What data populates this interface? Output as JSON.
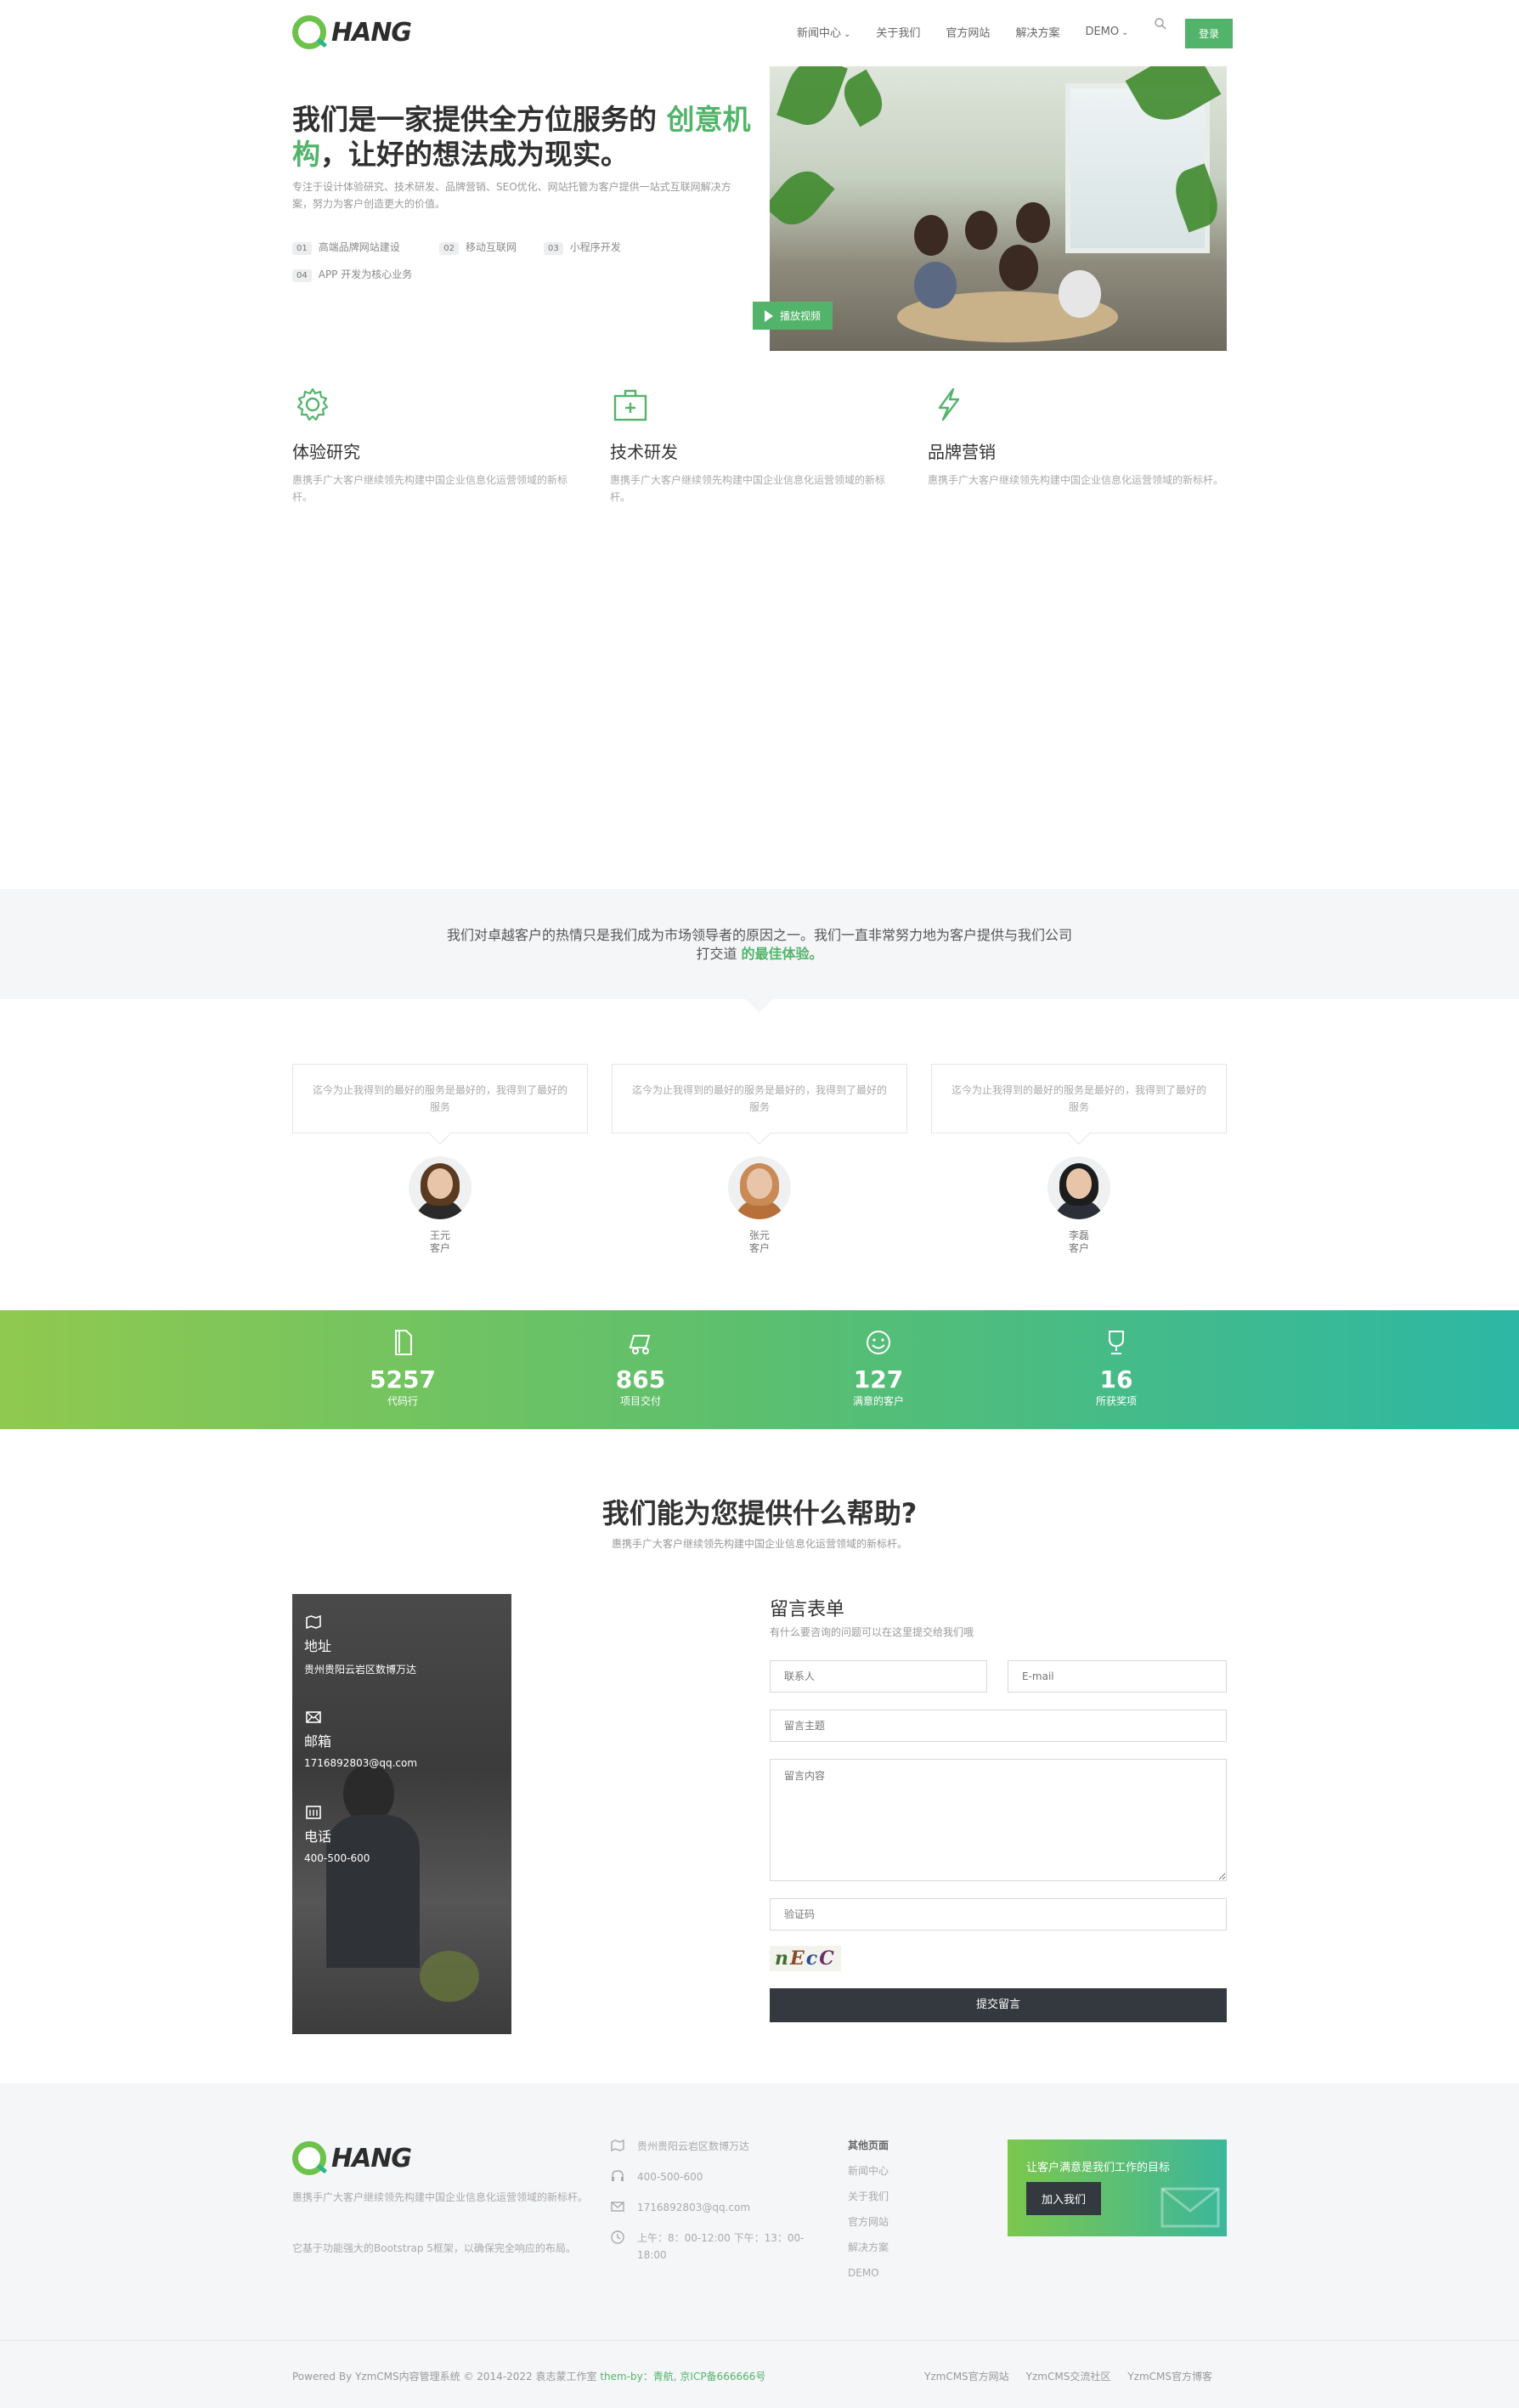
{
  "brand": {
    "name": "HANG"
  },
  "nav": {
    "items": [
      {
        "label": "新闻中心",
        "dropdown": true
      },
      {
        "label": "关于我们",
        "dropdown": false
      },
      {
        "label": "官方网站",
        "dropdown": false
      },
      {
        "label": "解决方案",
        "dropdown": false
      },
      {
        "label": "DEMO",
        "dropdown": true
      }
    ],
    "search_icon": "search-icon",
    "login": "登录"
  },
  "hero": {
    "title_a": "我们是一家提供全方位服务的 ",
    "title_highlight": "创意机构",
    "title_b": "，让好的想法成为现实。",
    "desc": "专注于设计体验研究、技术研发、品牌营销、SEO优化、网站托管为客户提供一站式互联网解决方案，努力为客户创造更大的价值。",
    "features": [
      {
        "num": "01",
        "label": "高端品牌网站建设"
      },
      {
        "num": "02",
        "label": "移动互联网"
      },
      {
        "num": "03",
        "label": "小程序开发"
      },
      {
        "num": "04",
        "label": "APP 开发为核心业务"
      }
    ],
    "play_label": "播放视频"
  },
  "services": [
    {
      "icon": "gear-icon",
      "title": "体验研究",
      "desc": "惠携手广大客户继续领先构建中国企业信息化运营领域的新标杆。"
    },
    {
      "icon": "briefcase-plus-icon",
      "title": "技术研发",
      "desc": "惠携手广大客户继续领先构建中国企业信息化运营领域的新标杆。"
    },
    {
      "icon": "lightning-icon",
      "title": "品牌营销",
      "desc": "惠携手广大客户继续领先构建中国企业信息化运营领域的新标杆。"
    }
  ],
  "band": {
    "text_a": "我们对卓越客户的热情只是我们成为市场领导者的原因之一。我们一直非常努力地为客户提供与我们公司打交道 ",
    "text_highlight": "的最佳体验。"
  },
  "testimonials": [
    {
      "quote": "迄今为止我得到的最好的服务是最好的，我得到了最好的服务",
      "name": "王元",
      "role": "客户"
    },
    {
      "quote": "迄今为止我得到的最好的服务是最好的，我得到了最好的服务",
      "name": "张元",
      "role": "客户"
    },
    {
      "quote": "迄今为止我得到的最好的服务是最好的，我得到了最好的服务",
      "name": "李磊",
      "role": "客户"
    }
  ],
  "stats": [
    {
      "icon": "document-icon",
      "value": "5257",
      "label": "代码行"
    },
    {
      "icon": "truck-icon",
      "value": "865",
      "label": "项目交付"
    },
    {
      "icon": "smile-icon",
      "value": "127",
      "label": "满意的客户"
    },
    {
      "icon": "trophy-icon",
      "value": "16",
      "label": "所获奖项"
    }
  ],
  "help": {
    "title": "我们能为您提供什么帮助?",
    "subtitle": "惠携手广大客户继续领先构建中国企业信息化运营领域的新标杆。"
  },
  "contact": {
    "address_label": "地址",
    "address": "贵州贵阳云岩区数博万达",
    "email_label": "邮箱",
    "email": "1716892803@qq.com",
    "phone_label": "电话",
    "phone": "400-500-600"
  },
  "form": {
    "title": "留言表单",
    "subtitle": "有什么要咨询的问题可以在这里提交给我们哦",
    "name_ph": "联系人",
    "email_ph": "E-mail",
    "subject_ph": "留言主题",
    "content_ph": "留言内容",
    "code_ph": "验证码",
    "captcha": "nEcC",
    "submit": "提交留言"
  },
  "footer": {
    "about_a": "惠携手广大客户继续领先构建中国企业信息化运营领域的新标杆。",
    "about_b": "它基于功能强大的Bootstrap 5框架，以确保完全响应的布局。",
    "address": "贵州贵阳云岩区数博万达",
    "phone": "400-500-600",
    "email": "1716892803@qq.com",
    "hours": "上午：8：00-12:00 下午：13：00-18:00",
    "links_head": "其他页面",
    "links": [
      "新闻中心",
      "关于我们",
      "官方网站",
      "解决方案",
      "DEMO"
    ],
    "cta_text": "让客户满意是我们工作的目标",
    "cta_btn": "加入我们"
  },
  "bottom": {
    "copyright": "Powered By YzmCMS内容管理系统 © 2014-2022 袁志蒙工作室 ",
    "theme_by": "them-by：青航",
    "icp": "京ICP备666666号",
    "links": [
      "YzmCMS官方网站",
      "YzmCMS交流社区",
      "YzmCMS官方博客"
    ]
  },
  "colors": {
    "accent": "#52b46a",
    "dark": "#34393f",
    "band_bg": "#f5f6f8"
  }
}
